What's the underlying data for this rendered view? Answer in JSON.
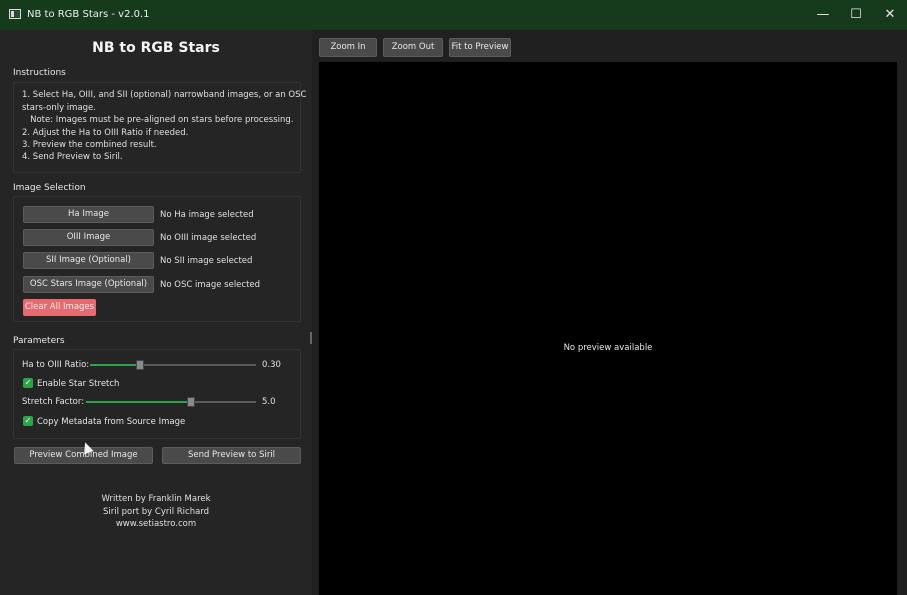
{
  "window": {
    "title": "NB to RGB Stars - v2.0.1",
    "controls": {
      "minimize": "—",
      "maximize": "☐",
      "close": "✕"
    }
  },
  "app": {
    "heading": "NB to RGB Stars"
  },
  "instructions": {
    "label": "Instructions",
    "lines": [
      "1. Select Ha, OIII, and SII (optional) narrowband images, or an OSC",
      "stars-only image.",
      "   Note: Images must be pre-aligned on stars before processing.",
      "2. Adjust the Ha to OIII Ratio if needed.",
      "3. Preview the combined result.",
      "4. Send Preview to Siril."
    ]
  },
  "image_selection": {
    "label": "Image Selection",
    "rows": [
      {
        "button": "Ha Image",
        "status": "No Ha image selected"
      },
      {
        "button": "OIII Image",
        "status": "No OIII image selected"
      },
      {
        "button": "SII Image (Optional)",
        "status": "No SII image selected"
      },
      {
        "button": "OSC Stars Image (Optional)",
        "status": "No OSC image selected"
      }
    ],
    "clear_button": "Clear All Images"
  },
  "parameters": {
    "label": "Parameters",
    "ratio": {
      "label": "Ha to OIII Ratio:",
      "value": "0.30",
      "level": 0.3
    },
    "enable_stretch": {
      "label": "Enable Star Stretch",
      "checked": true
    },
    "stretch_factor": {
      "label": "Stretch Factor:",
      "value": "5.0",
      "level": 0.62
    },
    "copy_metadata": {
      "label": "Copy Metadata from Source Image",
      "checked": true
    }
  },
  "actions": {
    "preview_button": "Preview Combined Image",
    "send_button": "Send Preview to Siril"
  },
  "credits": {
    "line1": "Written by Franklin Marek",
    "line2": "Siril port by Cyril Richard",
    "line3": "www.setiastro.com"
  },
  "toolbar": {
    "zoom_in": "Zoom In",
    "zoom_out": "Zoom Out",
    "fit": "Fit to Preview"
  },
  "preview": {
    "placeholder": "No preview available"
  },
  "colors": {
    "titlebar": "#163a1c",
    "accent_green": "#2fa34a",
    "clear_button": "#e56b70",
    "preview_bg": "#000000"
  }
}
